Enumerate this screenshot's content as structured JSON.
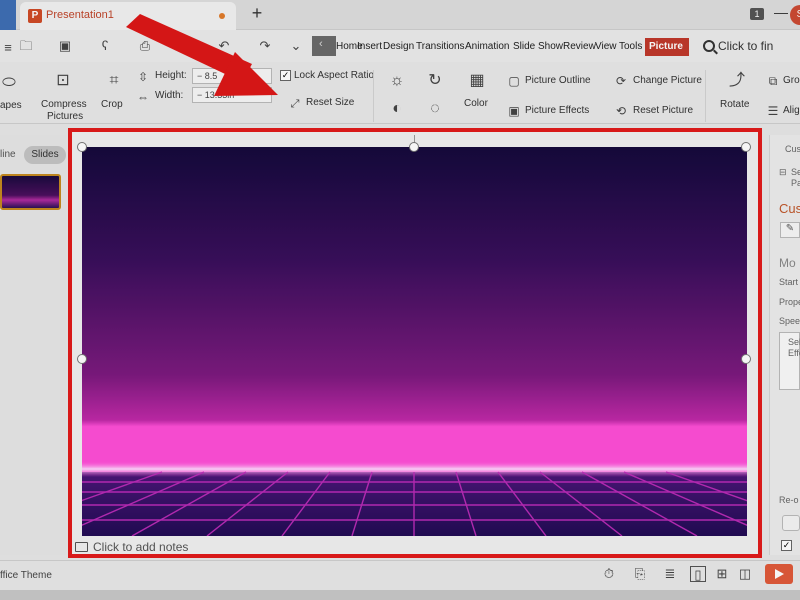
{
  "titlebar": {
    "doc_name": "Presentation1",
    "new_tab": "+",
    "badge": "1",
    "min": "—",
    "avatar_initial": "S"
  },
  "menus": {
    "items": [
      "Home",
      "Insert",
      "Design",
      "Transitions",
      "Animation",
      "Slide Show",
      "Review",
      "View",
      "Tools"
    ],
    "active_tab": "Picture",
    "search_placeholder": "Click to fin"
  },
  "ribbon": {
    "shapes_label": "apes",
    "compress_line1": "Compress",
    "compress_line2": "Pictures",
    "crop_label": "Crop",
    "height_label": "Height:",
    "height_value": "8.5",
    "width_label": "Width:",
    "width_value": "13.33in",
    "lock_aspect": "Lock Aspect Ratio",
    "reset_size": "Reset Size",
    "color_label": "Color",
    "picture_outline": "Picture Outline",
    "picture_effects": "Picture Effects",
    "change_picture": "Change Picture",
    "reset_picture": "Reset Picture",
    "rotate_label": "Rotate",
    "group_label": "Grou",
    "align_label": "Alig"
  },
  "left_panel": {
    "outline": "line",
    "slides": "Slides"
  },
  "slide": {
    "notes_placeholder": "Click to add notes"
  },
  "right_panel": {
    "tab": "Cus",
    "sel": "Se",
    "sel2": "Pa",
    "title": "Cust",
    "mod": "Mo",
    "start": "Start",
    "prop": "Prope",
    "speed": "Speed",
    "box1": "Sel",
    "box2": "Effe",
    "reorder": "Re-o"
  },
  "statusbar": {
    "theme": "ffice Theme"
  },
  "colors": {
    "highlight_border": "#e11b1b",
    "arrow": "#d41616",
    "picture_tab": "#c0392b",
    "sky_top": "#150a3c",
    "horizon_glow": "#ff4fd8",
    "grid_line": "#c02dbb"
  }
}
